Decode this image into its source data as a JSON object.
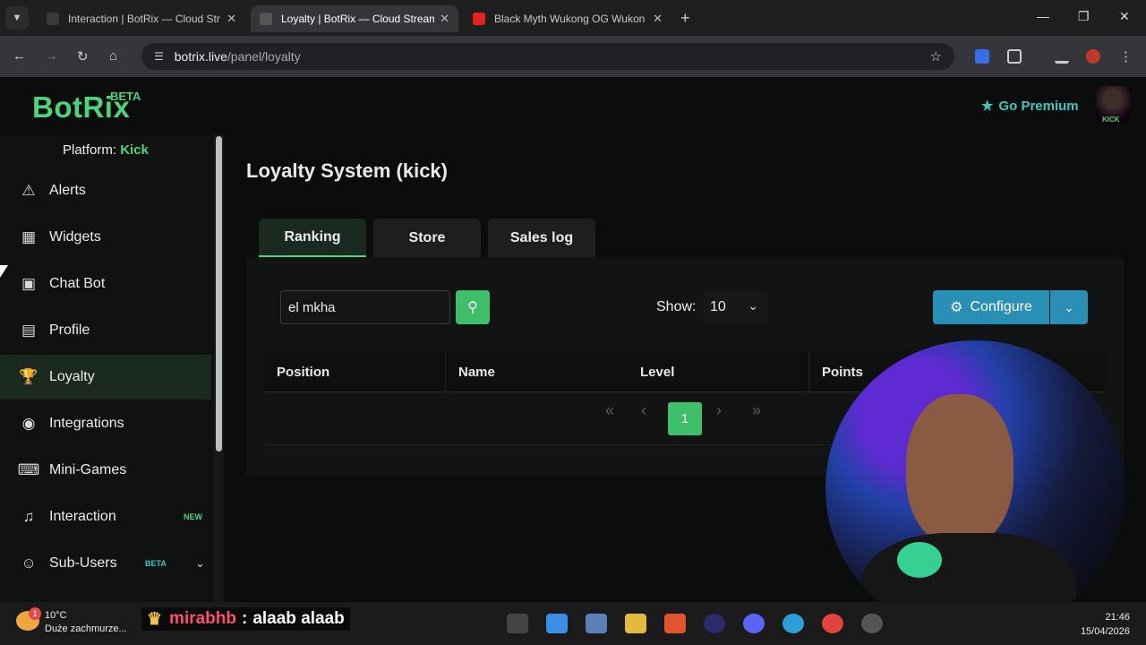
{
  "browser": {
    "tabs": [
      {
        "title": "Interaction | BotRix — Cloud Str",
        "active": false
      },
      {
        "title": "Loyalty | BotRix — Cloud Stream",
        "active": true
      },
      {
        "title": "Black Myth Wukong OG Wukon",
        "active": false
      }
    ],
    "address": {
      "host": "botrix.live",
      "path": "/panel/loyalty"
    }
  },
  "header": {
    "logo": "BotRix",
    "logo_badge": "BETA",
    "premium_label": "Go Premium",
    "avatar_label": "KICK"
  },
  "sidebar": {
    "platform_label": "Platform:",
    "platform_value": "Kick",
    "items": [
      {
        "label": "Alerts",
        "icon": "warning-icon"
      },
      {
        "label": "Widgets",
        "icon": "widgets-icon"
      },
      {
        "label": "Chat Bot",
        "icon": "robot-icon"
      },
      {
        "label": "Profile",
        "icon": "id-card-icon"
      },
      {
        "label": "Loyalty",
        "icon": "trophy-icon",
        "active": true
      },
      {
        "label": "Integrations",
        "icon": "discord-icon"
      },
      {
        "label": "Mini-Games",
        "icon": "gamepad-icon"
      },
      {
        "label": "Interaction",
        "icon": "music-icon",
        "badge": "NEW"
      },
      {
        "label": "Sub-Users",
        "icon": "users-icon",
        "badge": "BETA"
      }
    ]
  },
  "main": {
    "title": "Loyalty System (kick)",
    "tabs": [
      {
        "label": "Ranking",
        "active": true
      },
      {
        "label": "Store"
      },
      {
        "label": "Sales log"
      }
    ],
    "search_value": "el mkha",
    "show_label": "Show:",
    "show_value": "10",
    "configure_label": "Configure",
    "table_headers": [
      "Position",
      "Name",
      "Level",
      "Points"
    ],
    "pagination": {
      "current_page": "1"
    }
  },
  "taskbar": {
    "weather_temp": "10°C",
    "weather_desc": "Duże zachmurze...",
    "notification_count": "1",
    "chat_user": "mirabhb",
    "chat_separator": ":",
    "chat_message": "alaab alaab",
    "time": "21:46",
    "date": "15/04/2026"
  },
  "colors": {
    "accent": "#4ed27a",
    "configure": "#2a8fb4",
    "premium": "#3ec7c4"
  }
}
